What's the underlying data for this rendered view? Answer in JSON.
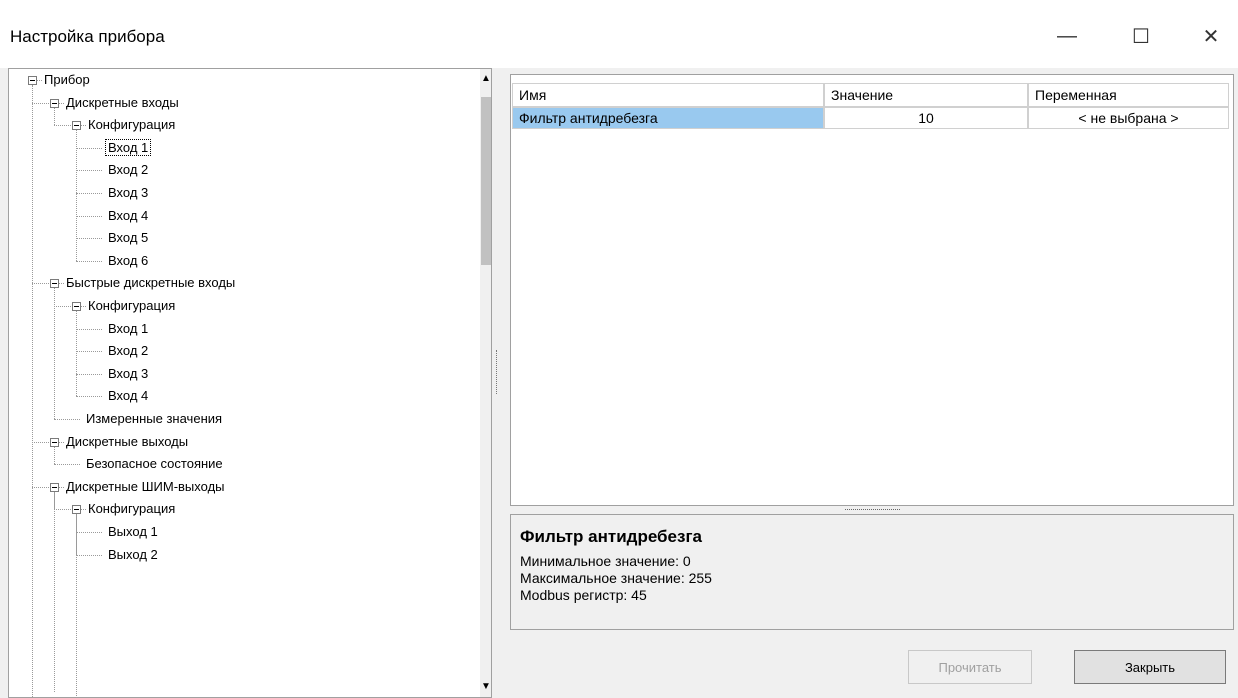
{
  "window": {
    "title": "Настройка прибора",
    "minimize_glyph": "—",
    "maximize_glyph": "☐",
    "close_glyph": "✕"
  },
  "tree": {
    "items": [
      {
        "label": "Прибор",
        "level": 0,
        "expandable": true
      },
      {
        "label": "Дискретные входы",
        "level": 1,
        "expandable": true
      },
      {
        "label": "Конфигурация",
        "level": 2,
        "expandable": true
      },
      {
        "label": "Вход 1",
        "level": 3,
        "expandable": false,
        "selected": true
      },
      {
        "label": "Вход 2",
        "level": 3,
        "expandable": false
      },
      {
        "label": "Вход 3",
        "level": 3,
        "expandable": false
      },
      {
        "label": "Вход 4",
        "level": 3,
        "expandable": false
      },
      {
        "label": "Вход 5",
        "level": 3,
        "expandable": false
      },
      {
        "label": "Вход 6",
        "level": 3,
        "expandable": false
      },
      {
        "label": "Быстрые дискретные входы",
        "level": 1,
        "expandable": true
      },
      {
        "label": "Конфигурация",
        "level": 2,
        "expandable": true
      },
      {
        "label": "Вход 1",
        "level": 3,
        "expandable": false
      },
      {
        "label": "Вход 2",
        "level": 3,
        "expandable": false
      },
      {
        "label": "Вход 3",
        "level": 3,
        "expandable": false
      },
      {
        "label": "Вход 4",
        "level": 3,
        "expandable": false
      },
      {
        "label": "Измеренные значения",
        "level": 2,
        "expandable": false
      },
      {
        "label": "Дискретные выходы",
        "level": 1,
        "expandable": true
      },
      {
        "label": "Безопасное состояние",
        "level": 2,
        "expandable": false
      },
      {
        "label": "Дискретные ШИМ-выходы",
        "level": 1,
        "expandable": true
      },
      {
        "label": "Конфигурация",
        "level": 2,
        "expandable": true
      },
      {
        "label": "Выход 1",
        "level": 3,
        "expandable": false
      },
      {
        "label": "Выход 2",
        "level": 3,
        "expandable": false
      }
    ],
    "scroll_up_glyph": "▲",
    "scroll_down_glyph": "▼"
  },
  "grid": {
    "headers": [
      "Имя",
      "Значение",
      "Переменная"
    ],
    "rows": [
      {
        "name": "Фильтр антидребезга",
        "value": "10",
        "variable": "< не выбрана >"
      }
    ]
  },
  "description": {
    "title": "Фильтр антидребезга",
    "lines": [
      "Минимальное значение: 0",
      "Максимальное значение: 255",
      "Modbus регистр: 45"
    ]
  },
  "buttons": {
    "read": "Прочитать",
    "close": "Закрыть"
  },
  "colors": {
    "selected_row": "#99c9ef",
    "window_bg": "#f0f0f0"
  }
}
